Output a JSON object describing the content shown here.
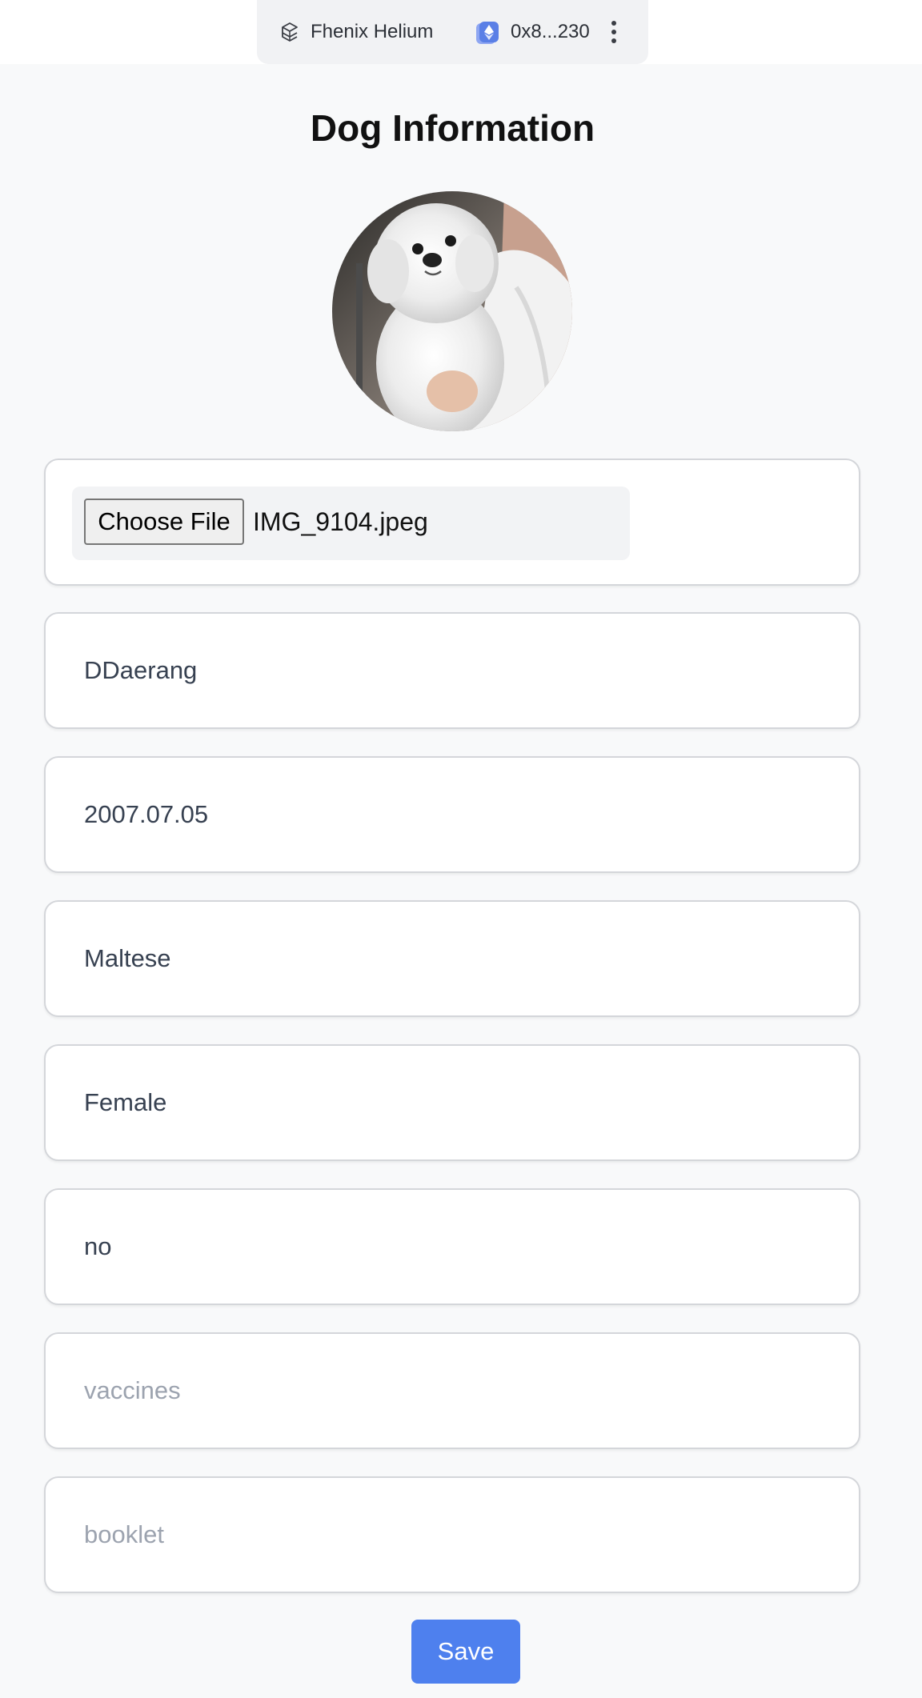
{
  "header": {
    "network_icon": "cube-network-icon",
    "network_name": "Fhenix Helium",
    "wallet_icon": "ethereum-wallet-icon",
    "wallet_address": "0x8...230",
    "more_icon": "kebab-menu-icon"
  },
  "page": {
    "title": "Dog Information",
    "photo_icon": "dog-photo"
  },
  "file_upload": {
    "button_label": "Choose File",
    "file_name": "IMG_9104.jpeg"
  },
  "fields": {
    "name": {
      "value": "DDaerang",
      "placeholder": ""
    },
    "birthdate": {
      "value": "2007.07.05",
      "placeholder": ""
    },
    "breed": {
      "value": "Maltese",
      "placeholder": ""
    },
    "gender": {
      "value": "Female",
      "placeholder": ""
    },
    "neutered": {
      "value": "no",
      "placeholder": ""
    },
    "vaccines": {
      "value": "",
      "placeholder": "vaccines"
    },
    "booklet": {
      "value": "",
      "placeholder": "booklet"
    }
  },
  "actions": {
    "save_label": "Save"
  },
  "colors": {
    "accent": "#4e80ee",
    "background": "#f8f9fa",
    "card_border": "#d4d6da",
    "placeholder": "#9ca3af"
  }
}
